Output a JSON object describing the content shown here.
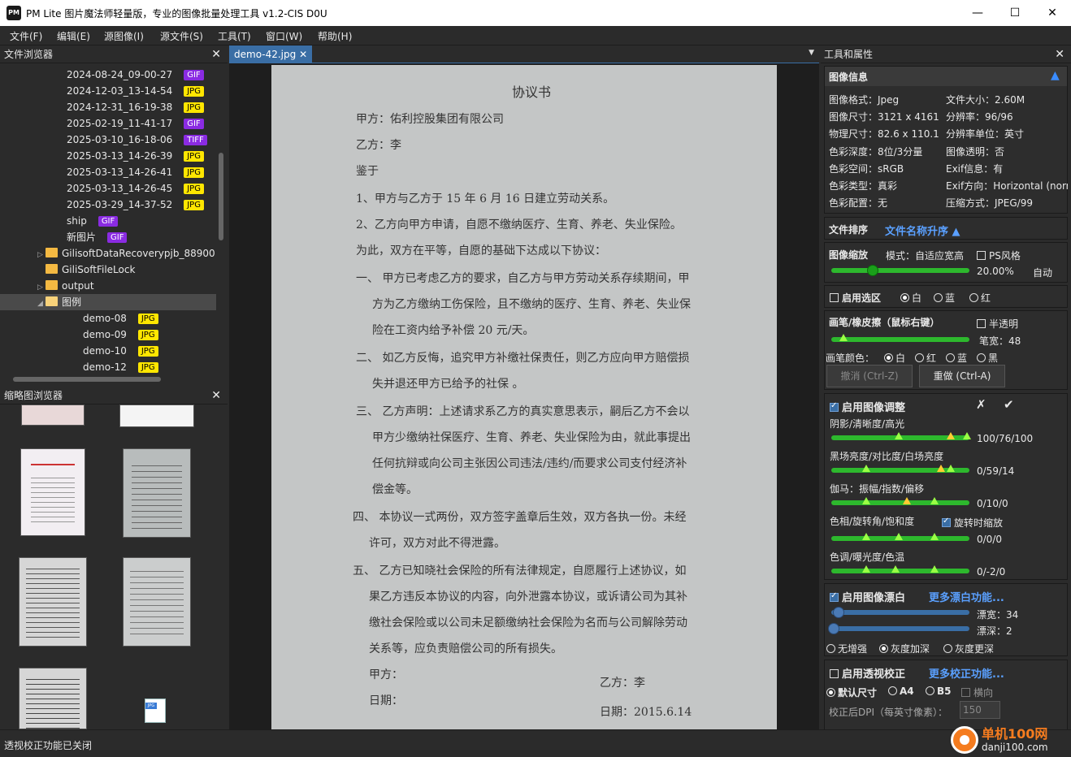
{
  "window": {
    "title": "PM Lite 图片魔法师轻量版，专业的图像批量处理工具 v1.2-CIS D0U",
    "icon": "PM",
    "minimize": "—",
    "maximize": "☐",
    "close": "✕"
  },
  "menu": [
    "文件(F)",
    "编辑(E)",
    "源图像(I)",
    "源文件(S)",
    "工具(T)",
    "窗口(W)",
    "帮助(H)"
  ],
  "file_browser": {
    "title": "文件浏览器",
    "items": [
      {
        "label": "2024-08-24_09-00-27",
        "badge": "GIF"
      },
      {
        "label": "2024-12-03_13-14-54",
        "badge": "JPG"
      },
      {
        "label": "2024-12-31_16-19-38",
        "badge": "JPG"
      },
      {
        "label": "2025-02-19_11-41-17",
        "badge": "GIF"
      },
      {
        "label": "2025-03-10_16-18-06",
        "badge": "TIFF"
      },
      {
        "label": "2025-03-13_14-26-39",
        "badge": "JPG"
      },
      {
        "label": "2025-03-13_14-26-41",
        "badge": "JPG"
      },
      {
        "label": "2025-03-13_14-26-45",
        "badge": "JPG"
      },
      {
        "label": "2025-03-29_14-37-52",
        "badge": "JPG"
      },
      {
        "label": "ship",
        "badge": "GIF"
      },
      {
        "label": "新图片",
        "badge": "GIF"
      }
    ],
    "folders": [
      "GilisoftDataRecoverypjb_88900",
      "GiliSoftFileLock",
      "output",
      "图例"
    ],
    "sub_items": [
      {
        "label": "demo-08",
        "badge": "JPG"
      },
      {
        "label": "demo-09",
        "badge": "JPG"
      },
      {
        "label": "demo-10",
        "badge": "JPG"
      },
      {
        "label": "demo-12",
        "badge": "JPG"
      }
    ]
  },
  "thumb_browser": {
    "title": "缩略图浏览器"
  },
  "viewer": {
    "tab": "demo-42.jpg",
    "tab_close": "✕"
  },
  "document": {
    "lines": [
      "协议书",
      "甲方：佑利控股集团有限公司",
      "乙方：李",
      "鉴于",
      "1、甲方与乙方于 15 年 6 月 16 日建立劳动关系。",
      "2、乙方向甲方申请，自愿不缴纳医疗、生育、养老、失业保险。",
      "为此，双方在平等，自愿的基础下达成以下协议：",
      "一、    甲方已考虑乙方的要求，自乙方与甲方劳动关系存续期间，甲",
      "方为乙方缴纳工伤保险，且不缴纳的医疗、生育、养老、失业保",
      "险在工资内给予补偿 20 元/天。",
      "二、    如乙方反悔，追究甲方补缴社保责任，则乙方应向甲方赔偿损",
      "失并退还甲方已给予的社保 。",
      "三、    乙方声明：上述请求系乙方的真实意思表示，嗣后乙方不会以",
      "甲方少缴纳社保医疗、生育、养老、失业保险为由，就此事提出",
      "任何抗辩或向公司主张因公司违法/违约/而要求公司支付经济补",
      "偿金等。",
      "四、    本协议一式两份，双方签字盖章后生效，双方各执一份。未经",
      "许可，双方对此不得泄露。",
      "五、    乙方已知晓社会保险的所有法律规定，自愿履行上述协议，如",
      "果乙方违反本协议的内容，向外泄露本协议，或诉请公司为其补",
      "缴社会保险或以公司未足额缴纳社会保险为名而与公司解除劳动",
      "关系等，应负责赔偿公司的所有损失。",
      "甲方：",
      "乙方：李",
      "日期：",
      "日期：2015.6.14"
    ]
  },
  "tools": {
    "title": "工具和属性",
    "image_info": {
      "title": "图像信息",
      "collapse": "▲",
      "rows": [
        [
          "图像格式：Jpeg",
          "文件大小：2.60M"
        ],
        [
          "图像尺寸：3121 x 4161",
          "分辨率：96/96"
        ],
        [
          "物理尺寸：82.6 x 110.1",
          "分辨率单位：英寸"
        ],
        [
          "色彩深度：8位/3分量",
          "图像透明：否"
        ],
        [
          "色彩空间：sRGB",
          "Exif信息：有"
        ],
        [
          "色彩类型：真彩",
          "Exif方向：Horizontal (norm"
        ],
        [
          "色彩配置：无",
          "压缩方式：JPEG/99"
        ]
      ]
    },
    "sort": {
      "label": "文件排序",
      "value": "文件名称升序 ▲"
    },
    "zoom": {
      "label": "图像缩放",
      "mode": "模式：自适应宽高",
      "ps_style": "PS风格",
      "percent": "20.00%",
      "auto": "自动",
      "level": 0.3
    },
    "selection": {
      "enable": "启用选区",
      "opt1": "白",
      "opt2": "蓝",
      "opt3": "红"
    },
    "brush": {
      "label": "画笔/橡皮擦（鼠标右键）",
      "semi": "半透明",
      "width_label": "笔宽：48",
      "color_label": "画笔颜色：",
      "c1": "白",
      "c2": "红",
      "c3": "蓝",
      "c4": "黑",
      "undo": "撤消 (Ctrl-Z)",
      "redo": "重做 (Ctrl-A)"
    },
    "adjust": {
      "enable": "启用图像调整",
      "cancel": "✗",
      "ok": "✔",
      "shadow_label": "阴影/清晰度/高光",
      "shadow_value": "100/76/100",
      "black_label": "黑场亮度/对比度/白场亮度",
      "black_value": "0/59/14",
      "gamma_label": "伽马：振幅/指数/偏移",
      "gamma_value": "0/10/0",
      "hue_label": "色相/旋转角/饱和度",
      "rotate_zoom": "旋转时缩放",
      "hue_value": "0/0/0",
      "tone_label": "色调/曝光度/色温",
      "tone_value": "0/-2/0"
    },
    "bleach": {
      "enable": "启用图像漂白",
      "more": "更多漂白功能...",
      "width": "漂宽：34",
      "depth": "漂深：2",
      "o1": "无增强",
      "o2": "灰度加深",
      "o3": "灰度更深"
    },
    "perspective": {
      "enable": "启用透视校正",
      "more": "更多校正功能...",
      "o1": "默认尺寸",
      "o2": "A4",
      "o3": "B5",
      "landscape": "横向",
      "dpi_label": "校正后DPI（每英寸像素）：",
      "dpi_value": "150"
    }
  },
  "status": {
    "text": "透视校正功能已关闭"
  },
  "watermark": {
    "text1": "单机100网",
    "text2": "danji100.com"
  }
}
